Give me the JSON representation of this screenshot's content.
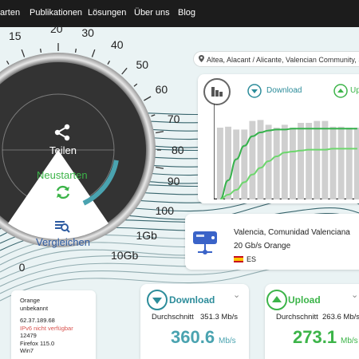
{
  "nav": {
    "items": [
      "arten",
      "Publikationen",
      "Lösungen",
      "Über uns",
      "Blog"
    ]
  },
  "location": {
    "text": "Altea, Alacant / Alicante, Valencian Community, Spain"
  },
  "gauge": {
    "scale_labels": [
      "15",
      "20",
      "30",
      "40",
      "50",
      "60",
      "70",
      "80",
      "90",
      "100",
      "1Gb",
      "10Gb",
      "0"
    ],
    "share_label": "Teilen",
    "restart_label": "Neustarten",
    "compare_label": "Vergleichen",
    "progress_fraction": 0.3
  },
  "toggle": {
    "download_label": "Download",
    "upload_label": "Upload"
  },
  "server": {
    "location": "Valencia, Comunidad Valenciana",
    "provider": "20 Gb/s Orange",
    "country": "ES"
  },
  "client_info": {
    "lines": [
      "Orange",
      "unbekannt",
      "62.37.189.68",
      "IPv6 nicht verfügbar",
      "12479",
      "Firefox 115.0",
      "Win7"
    ],
    "warning_color": "#d9534f"
  },
  "download": {
    "title": "Download",
    "avg_label": "Durchschnitt",
    "avg_value": "351.3 Mb/s",
    "big_value": "360.6",
    "unit": "Mb/s",
    "more": "⌄"
  },
  "upload": {
    "title": "Upload",
    "avg_label": "Durchschnitt",
    "avg_value": "263.6 Mb/s",
    "big_value": "273.1",
    "unit": "Mb/s",
    "more": "⌄"
  },
  "colors": {
    "accent_teal": "#2c8c9a",
    "accent_green": "#3cb449",
    "green_line": "#6ed66e",
    "bar_gray": "#cfcfcf",
    "nav_bg": "#1c1c1c",
    "gauge_dark": "#343434"
  },
  "chart_data": {
    "type": "bar",
    "series": [
      {
        "values": [
          0.75,
          0.76,
          0.73,
          0.73,
          0.82,
          0.83,
          0.78,
          0.75,
          0.78,
          0.75,
          0.8,
          0.8,
          0.82,
          0.82,
          0.76,
          0.76,
          0.75,
          0.75
        ]
      }
    ],
    "lines": [
      {
        "color": "dark-green",
        "values": [
          0.0,
          0.2,
          0.42,
          0.56,
          0.66,
          0.7,
          0.72,
          0.73,
          0.73,
          0.74,
          0.74,
          0.74,
          0.74,
          0.74,
          0.74,
          0.74,
          0.74,
          0.74
        ]
      },
      {
        "color": "light-green",
        "values": [
          0.0,
          0.05,
          0.1,
          0.18,
          0.26,
          0.33,
          0.4,
          0.45,
          0.49,
          0.5,
          0.51,
          0.52,
          0.52,
          0.52,
          0.53,
          0.53,
          0.53,
          0.53
        ]
      }
    ],
    "ylim": [
      0,
      1
    ],
    "grid": false
  }
}
